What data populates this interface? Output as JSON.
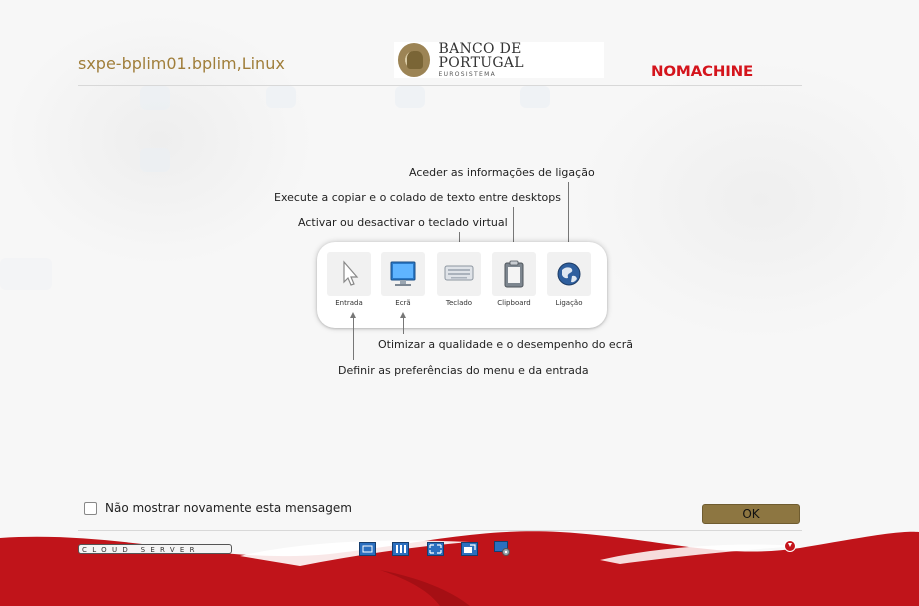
{
  "header": {
    "server_name": "sxpe-bplim01.bplim,Linux",
    "bank_name": "BANCO DE PORTUGAL",
    "bank_sub": "EUROSISTEMA",
    "brand": "NOMACHINE"
  },
  "callouts": {
    "ligacao": "Aceder as informações de ligação",
    "clipboard": "Execute a copiar e o colado de texto entre desktops",
    "teclado": "Activar ou desactivar o teclado virtual",
    "ecra": "Otimizar a qualidade e o desempenho do ecrã",
    "entrada": "Definir as preferências do menu e da entrada"
  },
  "toolbar": {
    "items": [
      {
        "label": "Entrada",
        "icon": "pointer-icon"
      },
      {
        "label": "Ecrã",
        "icon": "monitor-icon"
      },
      {
        "label": "Teclado",
        "icon": "keyboard-icon"
      },
      {
        "label": "Clipboard",
        "icon": "clipboard-icon"
      },
      {
        "label": "Ligação",
        "icon": "globe-icon"
      }
    ]
  },
  "footer": {
    "dont_show_label": "Não mostrar novamente esta mensagem",
    "dont_show_checked": false,
    "ok_label": "OK",
    "cloud_server": "CLOUD SERVER",
    "icons": [
      "view-fit-icon",
      "view-scale-icon",
      "fullscreen-icon",
      "window-icon",
      "monitor-settings-icon"
    ]
  },
  "colors": {
    "gold": "#a07e3a",
    "ok_button": "#8d7641",
    "nomachine_red": "#d4141c",
    "wave_red": "#c0141a"
  }
}
